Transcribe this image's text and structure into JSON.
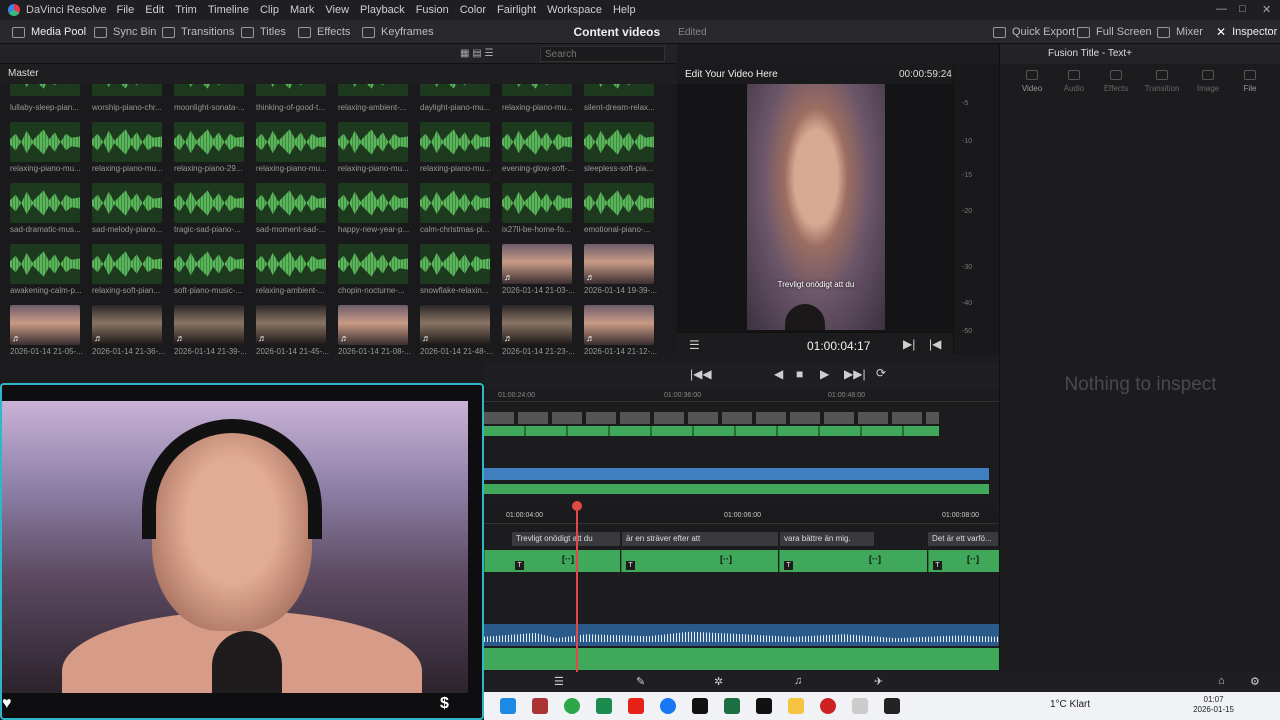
{
  "app": {
    "name": "DaVinci Resolve",
    "menu": [
      "File",
      "Edit",
      "Trim",
      "Timeline",
      "Clip",
      "Mark",
      "View",
      "Playback",
      "Fusion",
      "Color",
      "Fairlight",
      "Workspace",
      "Help"
    ]
  },
  "toolbar": {
    "media_pool": "Media Pool",
    "sync_bin": "Sync Bin",
    "transitions": "Transitions",
    "titles": "Titles",
    "effects": "Effects",
    "keyframes": "Keyframes",
    "project_title": "Content videos",
    "project_status": "Edited",
    "quick_export": "Quick Export",
    "full_screen": "Full Screen",
    "mixer": "Mixer",
    "inspector": "Inspector"
  },
  "bin": {
    "search_placeholder": "Search",
    "master_label": "Master"
  },
  "pool": {
    "top_row_labels": [
      "lullaby-sleep-pian...",
      "worship-piano-chr...",
      "moonlight-sonata-...",
      "thinking-of-good-t...",
      "relaxing-ambient-...",
      "daylight-piano-mu...",
      "relaxing-piano-mu...",
      "silent-dream-relax..."
    ],
    "rows": [
      [
        {
          "label": "relaxing-piano-mu...",
          "type": "audio"
        },
        {
          "label": "relaxing-piano-mu...",
          "type": "audio"
        },
        {
          "label": "relaxing-piano-29...",
          "type": "audio"
        },
        {
          "label": "relaxing-piano-mu...",
          "type": "audio"
        },
        {
          "label": "relaxing-piano-mu...",
          "type": "audio"
        },
        {
          "label": "relaxing-piano-mu...",
          "type": "audio"
        },
        {
          "label": "evening-glow-soft-...",
          "type": "audio"
        },
        {
          "label": "sleepless-soft-pia...",
          "type": "audio"
        }
      ],
      [
        {
          "label": "sad-dramatic-mus...",
          "type": "audio"
        },
        {
          "label": "sad-melody-piano...",
          "type": "audio"
        },
        {
          "label": "tragic-sad-piano-...",
          "type": "audio"
        },
        {
          "label": "sad-moment-sad-...",
          "type": "audio"
        },
        {
          "label": "happy-new-year-p...",
          "type": "audio"
        },
        {
          "label": "calm-christmas-pi...",
          "type": "audio"
        },
        {
          "label": "ix27ll-be-home-fo...",
          "type": "audio"
        },
        {
          "label": "emotional-piano-...",
          "type": "audio"
        }
      ],
      [
        {
          "label": "awakening-calm-p...",
          "type": "audio"
        },
        {
          "label": "relaxing-soft-pian...",
          "type": "audio"
        },
        {
          "label": "soft-piano-music-...",
          "type": "audio"
        },
        {
          "label": "relaxing-ambient-...",
          "type": "audio"
        },
        {
          "label": "chopin-nocturne-...",
          "type": "audio"
        },
        {
          "label": "snowflake-relaxin...",
          "type": "audio"
        },
        {
          "label": "2026-01-14 21-03-...",
          "type": "video"
        },
        {
          "label": "2026-01-14 19-39-...",
          "type": "video"
        }
      ],
      [
        {
          "label": "2026-01-14 21-05-...",
          "type": "video"
        },
        {
          "label": "2026-01-14 21-36-...",
          "type": "dark"
        },
        {
          "label": "2026-01-14 21-39-...",
          "type": "dark"
        },
        {
          "label": "2026-01-14 21-45-...",
          "type": "dark"
        },
        {
          "label": "2026-01-14 21-08-...",
          "type": "video"
        },
        {
          "label": "2026-01-14 21-48-...",
          "type": "dark"
        },
        {
          "label": "2026-01-14 21-23-...",
          "type": "dark"
        },
        {
          "label": "2026-01-14 21-12-...",
          "type": "video"
        }
      ]
    ]
  },
  "viewer": {
    "clip_name": "Edit Your Video Here",
    "duration": "00:00:59:24",
    "subtitle": "Trevligt onödigt att du",
    "timecode": "01:00:04:17"
  },
  "meter": {
    "ticks": [
      "-5",
      "-10",
      "-15",
      "-20",
      "-30",
      "-40",
      "-50"
    ]
  },
  "inspector": {
    "title": "Fusion Title - Text+",
    "tabs": [
      "Video",
      "Audio",
      "Effects",
      "Transition",
      "Image",
      "File"
    ],
    "empty": "Nothing to inspect"
  },
  "timeline": {
    "ruler_top": [
      "01:00:24:00",
      "01:00:36:00",
      "01:00:48:00"
    ],
    "ruler_main": [
      "01:00:04:00",
      "01:00:06:00",
      "01:00:08:00"
    ],
    "subtitles": [
      "Trevligt onödigt att du",
      "är en sträver efter att",
      "vara bättre än mig.",
      "Det är ett varfö..."
    ]
  },
  "taskbar": {
    "weather": "1°C  Klart",
    "time": "01:07",
    "date": "2026-01-15"
  },
  "webcam": {
    "dollar_icon": "$"
  }
}
